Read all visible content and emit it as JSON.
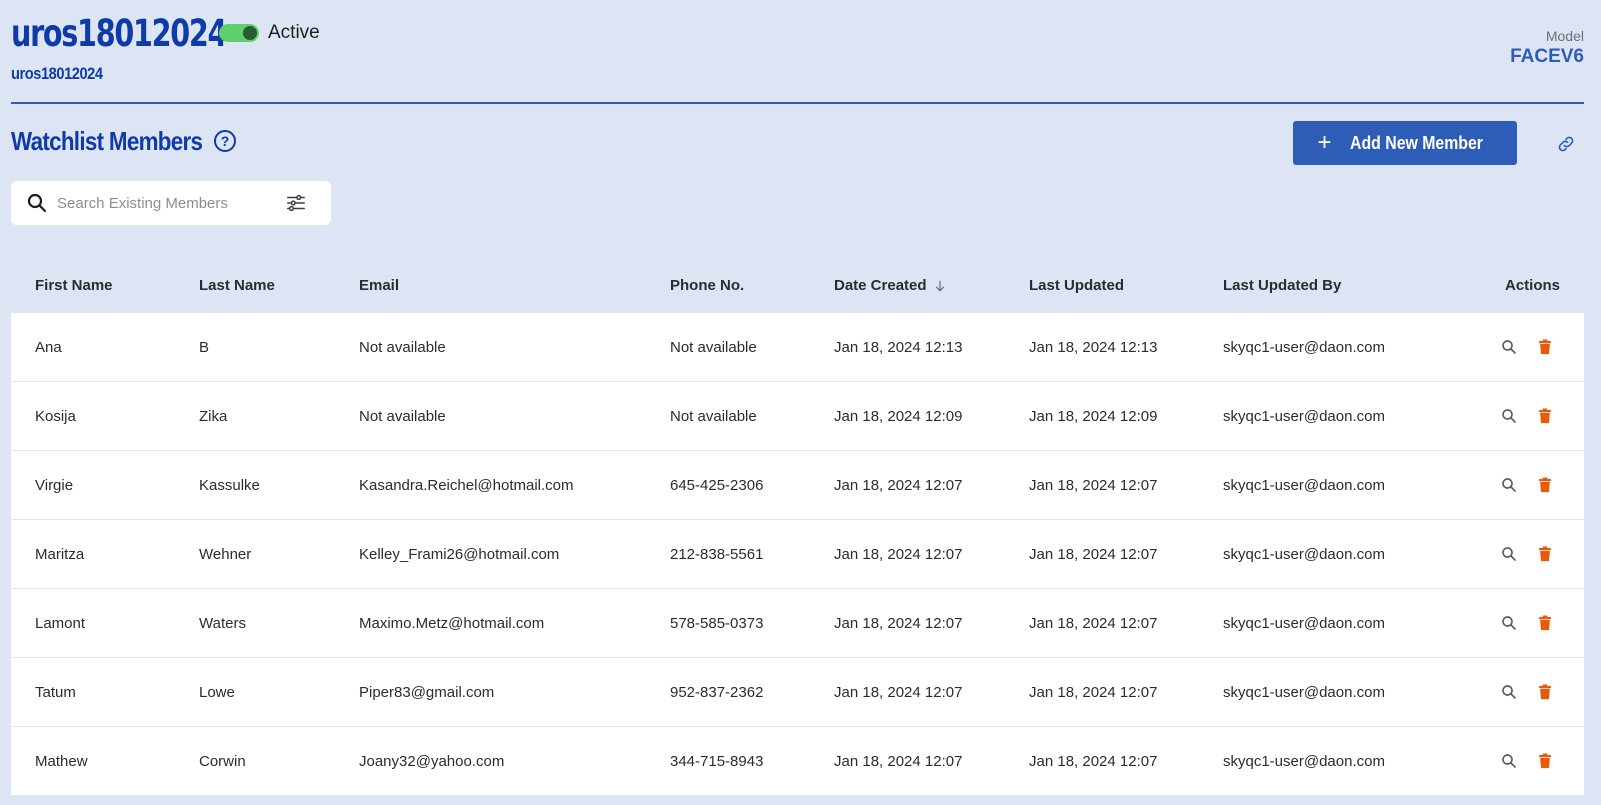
{
  "header": {
    "title": "uros18012024",
    "subtitle": "uros18012024",
    "status": "Active",
    "model_label": "Model",
    "model_value": "FACEV6"
  },
  "section": {
    "title": "Watchlist Members",
    "add_button_label": "Add New Member"
  },
  "search": {
    "placeholder": "Search Existing Members",
    "value": ""
  },
  "table": {
    "columns": [
      "First Name",
      "Last Name",
      "Email",
      "Phone No.",
      "Date Created",
      "Last Updated",
      "Last Updated By",
      "Actions"
    ],
    "rows": [
      {
        "first": "Ana",
        "last": "B",
        "email": "Not available",
        "phone": "Not available",
        "created": "Jan 18, 2024 12:13",
        "updated": "Jan 18, 2024 12:13",
        "by": "skyqc1-user@daon.com"
      },
      {
        "first": "Kosija",
        "last": "Zika",
        "email": "Not available",
        "phone": "Not available",
        "created": "Jan 18, 2024 12:09",
        "updated": "Jan 18, 2024 12:09",
        "by": "skyqc1-user@daon.com"
      },
      {
        "first": "Virgie",
        "last": "Kassulke",
        "email": "Kasandra.Reichel@hotmail.com",
        "phone": "645-425-2306",
        "created": "Jan 18, 2024 12:07",
        "updated": "Jan 18, 2024 12:07",
        "by": "skyqc1-user@daon.com"
      },
      {
        "first": "Maritza",
        "last": "Wehner",
        "email": "Kelley_Frami26@hotmail.com",
        "phone": "212-838-5561",
        "created": "Jan 18, 2024 12:07",
        "updated": "Jan 18, 2024 12:07",
        "by": "skyqc1-user@daon.com"
      },
      {
        "first": "Lamont",
        "last": "Waters",
        "email": "Maximo.Metz@hotmail.com",
        "phone": "578-585-0373",
        "created": "Jan 18, 2024 12:07",
        "updated": "Jan 18, 2024 12:07",
        "by": "skyqc1-user@daon.com"
      },
      {
        "first": "Tatum",
        "last": "Lowe",
        "email": "Piper83@gmail.com",
        "phone": "952-837-2362",
        "created": "Jan 18, 2024 12:07",
        "updated": "Jan 18, 2024 12:07",
        "by": "skyqc1-user@daon.com"
      },
      {
        "first": "Mathew",
        "last": "Corwin",
        "email": "Joany32@yahoo.com",
        "phone": "344-715-8943",
        "created": "Jan 18, 2024 12:07",
        "updated": "Jan 18, 2024 12:07",
        "by": "skyqc1-user@daon.com"
      }
    ]
  },
  "icons": {
    "search": "search-icon",
    "filter": "filter-sliders-icon",
    "help": "help-circle-icon",
    "link": "link-icon",
    "view": "magnifier-icon",
    "delete": "trash-icon",
    "sort": "arrow-down-icon"
  },
  "colors": {
    "background": "#dde5f4",
    "brand": "#0e3ba8",
    "button": "#2e5db8",
    "toggle_on": "#5fcf6b",
    "delete": "#e8590c"
  }
}
